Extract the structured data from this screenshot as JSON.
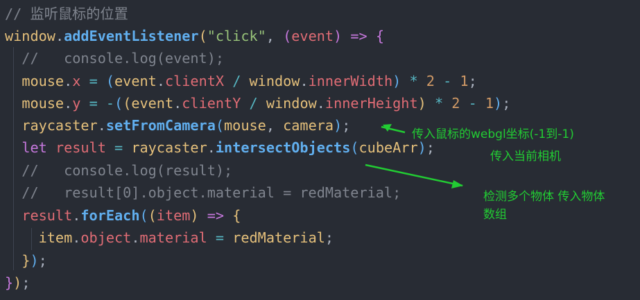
{
  "lines": [
    [
      [
        "c-comment",
        "// 监听鼠标的位置"
      ]
    ],
    [
      [
        "c-var",
        "window"
      ],
      [
        "c-plain",
        "."
      ],
      [
        "c-fn",
        "addEventListener"
      ],
      [
        "c-br1",
        "("
      ],
      [
        "c-str",
        "\"click\""
      ],
      [
        "c-plain",
        ", "
      ],
      [
        "c-br2",
        "("
      ],
      [
        "c-param",
        "event"
      ],
      [
        "c-br2",
        ")"
      ],
      [
        "c-plain",
        " "
      ],
      [
        "c-kw",
        "=>"
      ],
      [
        "c-plain",
        " "
      ],
      [
        "c-br2",
        "{"
      ]
    ],
    [
      [
        "c-comment",
        "  //   console.log(event);"
      ]
    ],
    [
      [
        "c-plain",
        "  "
      ],
      [
        "c-var",
        "mouse"
      ],
      [
        "c-plain",
        "."
      ],
      [
        "c-prop",
        "x"
      ],
      [
        "c-plain",
        " "
      ],
      [
        "c-op",
        "="
      ],
      [
        "c-plain",
        " "
      ],
      [
        "c-br3",
        "("
      ],
      [
        "c-var",
        "event"
      ],
      [
        "c-plain",
        "."
      ],
      [
        "c-prop",
        "clientX"
      ],
      [
        "c-plain",
        " "
      ],
      [
        "c-op",
        "/"
      ],
      [
        "c-plain",
        " "
      ],
      [
        "c-var",
        "window"
      ],
      [
        "c-plain",
        "."
      ],
      [
        "c-prop",
        "innerWidth"
      ],
      [
        "c-br3",
        ")"
      ],
      [
        "c-plain",
        " "
      ],
      [
        "c-op",
        "*"
      ],
      [
        "c-plain",
        " "
      ],
      [
        "c-num",
        "2"
      ],
      [
        "c-plain",
        " "
      ],
      [
        "c-op",
        "-"
      ],
      [
        "c-plain",
        " "
      ],
      [
        "c-num",
        "1"
      ],
      [
        "c-plain",
        ";"
      ]
    ],
    [
      [
        "c-plain",
        "  "
      ],
      [
        "c-var",
        "mouse"
      ],
      [
        "c-plain",
        "."
      ],
      [
        "c-prop",
        "y"
      ],
      [
        "c-plain",
        " "
      ],
      [
        "c-op",
        "="
      ],
      [
        "c-plain",
        " "
      ],
      [
        "c-op",
        "-"
      ],
      [
        "c-br3",
        "("
      ],
      [
        "c-br1",
        "("
      ],
      [
        "c-var",
        "event"
      ],
      [
        "c-plain",
        "."
      ],
      [
        "c-prop",
        "clientY"
      ],
      [
        "c-plain",
        " "
      ],
      [
        "c-op",
        "/"
      ],
      [
        "c-plain",
        " "
      ],
      [
        "c-var",
        "window"
      ],
      [
        "c-plain",
        "."
      ],
      [
        "c-prop",
        "innerHeight"
      ],
      [
        "c-br1",
        ")"
      ],
      [
        "c-plain",
        " "
      ],
      [
        "c-op",
        "*"
      ],
      [
        "c-plain",
        " "
      ],
      [
        "c-num",
        "2"
      ],
      [
        "c-plain",
        " "
      ],
      [
        "c-op",
        "-"
      ],
      [
        "c-plain",
        " "
      ],
      [
        "c-num",
        "1"
      ],
      [
        "c-br3",
        ")"
      ],
      [
        "c-plain",
        ";"
      ]
    ],
    [
      [
        "c-plain",
        "  "
      ],
      [
        "c-var",
        "raycaster"
      ],
      [
        "c-plain",
        "."
      ],
      [
        "c-fn",
        "setFromCamera"
      ],
      [
        "c-br3",
        "("
      ],
      [
        "c-var",
        "mouse"
      ],
      [
        "c-plain",
        ", "
      ],
      [
        "c-var",
        "camera"
      ],
      [
        "c-br3",
        ")"
      ],
      [
        "c-plain",
        ";"
      ]
    ],
    [
      [
        "c-plain",
        "  "
      ],
      [
        "c-kw",
        "let"
      ],
      [
        "c-plain",
        " "
      ],
      [
        "c-prop",
        "result"
      ],
      [
        "c-plain",
        " "
      ],
      [
        "c-op",
        "="
      ],
      [
        "c-plain",
        " "
      ],
      [
        "c-var",
        "raycaster"
      ],
      [
        "c-plain",
        "."
      ],
      [
        "c-fn",
        "intersectObjects"
      ],
      [
        "c-br3",
        "("
      ],
      [
        "c-var",
        "cubeArr"
      ],
      [
        "c-br3",
        ")"
      ],
      [
        "c-plain",
        ";"
      ]
    ],
    [
      [
        "c-comment",
        "  //   console.log(result);"
      ]
    ],
    [
      [
        "c-comment",
        "  //   result[0].object.material = redMaterial;"
      ]
    ],
    [
      [
        "c-plain",
        "  "
      ],
      [
        "c-prop",
        "result"
      ],
      [
        "c-plain",
        "."
      ],
      [
        "c-fn",
        "forEach"
      ],
      [
        "c-br3",
        "("
      ],
      [
        "c-br1",
        "("
      ],
      [
        "c-param",
        "item"
      ],
      [
        "c-br1",
        ")"
      ],
      [
        "c-plain",
        " "
      ],
      [
        "c-kw",
        "=>"
      ],
      [
        "c-plain",
        " "
      ],
      [
        "c-br1",
        "{"
      ]
    ],
    [
      [
        "c-plain",
        "    "
      ],
      [
        "c-var",
        "item"
      ],
      [
        "c-plain",
        "."
      ],
      [
        "c-prop",
        "object"
      ],
      [
        "c-plain",
        "."
      ],
      [
        "c-prop",
        "material"
      ],
      [
        "c-plain",
        " "
      ],
      [
        "c-op",
        "="
      ],
      [
        "c-plain",
        " "
      ],
      [
        "c-var",
        "redMaterial"
      ],
      [
        "c-plain",
        ";"
      ]
    ],
    [
      [
        "c-plain",
        "  "
      ],
      [
        "c-br1",
        "}"
      ],
      [
        "c-br3",
        ")"
      ],
      [
        "c-plain",
        ";"
      ]
    ],
    [
      [
        "c-br2",
        "}"
      ],
      [
        "c-br1",
        ")"
      ],
      [
        "c-plain",
        ";"
      ]
    ]
  ],
  "annotations": {
    "a1": "传入鼠标的webgl坐标(-1到-1)",
    "a2": "传入当前相机",
    "a3_line1": "检测多个物体 传入物体",
    "a3_line2": "数组"
  },
  "colors": {
    "background": "#282c34",
    "annotation": "#22cc33"
  }
}
